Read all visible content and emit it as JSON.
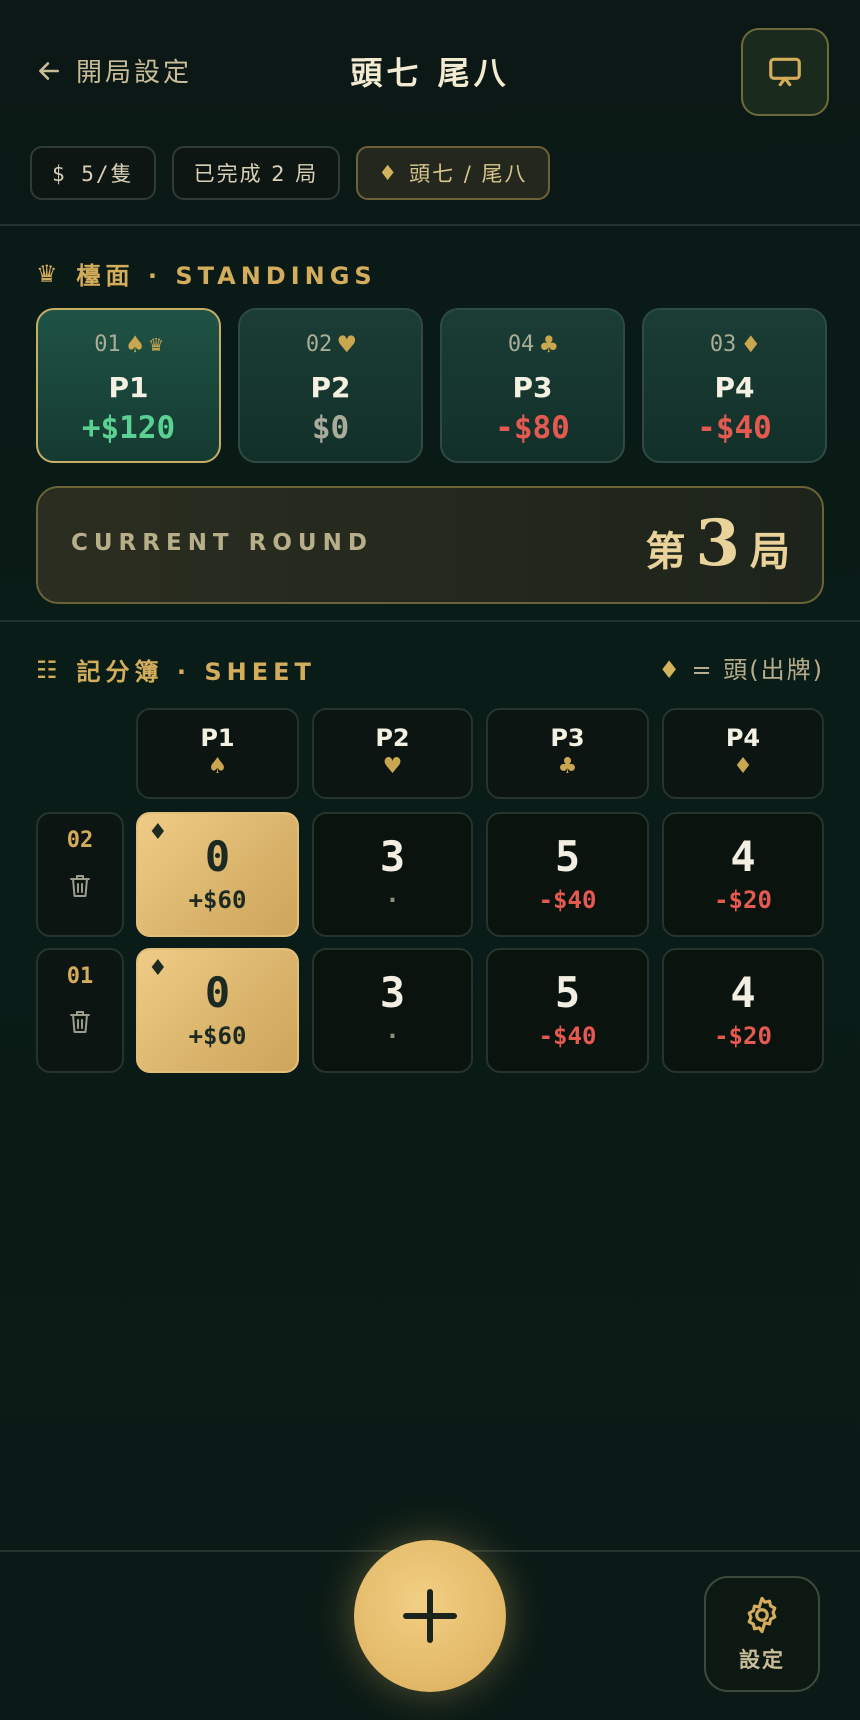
{
  "header": {
    "back_label": "開局設定",
    "title": "頭七 尾八"
  },
  "chips": {
    "stake": "$ 5/隻",
    "completed": "已完成 2 局",
    "rule_icon": "♦",
    "rule": "頭七 / 尾八"
  },
  "standings": {
    "icon": "♛",
    "label": "檯面 · STANDINGS",
    "players": [
      {
        "seat": "01",
        "suit": "♠",
        "crown": "♛",
        "name": "P1",
        "amount": "+$120"
      },
      {
        "seat": "02",
        "suit": "♥",
        "crown": "",
        "name": "P2",
        "amount": "$0"
      },
      {
        "seat": "04",
        "suit": "♣",
        "crown": "",
        "name": "P3",
        "amount": "-$80"
      },
      {
        "seat": "03",
        "suit": "♦",
        "crown": "",
        "name": "P4",
        "amount": "-$40"
      }
    ]
  },
  "current_round": {
    "label": "CURRENT ROUND",
    "prefix": "第",
    "number": "3",
    "suffix": "局"
  },
  "sheet": {
    "icon": "☷",
    "label": "記分簿 · SHEET",
    "legend_icon": "♦",
    "legend": "= 頭(出牌)",
    "headers": [
      {
        "name": "P1",
        "suit": "♠"
      },
      {
        "name": "P2",
        "suit": "♥"
      },
      {
        "name": "P3",
        "suit": "♣"
      },
      {
        "name": "P4",
        "suit": "♦"
      }
    ],
    "rows": [
      {
        "round": "02",
        "cells": [
          {
            "marker": "♦",
            "score": "0",
            "money": "+$60"
          },
          {
            "marker": "",
            "score": "3",
            "money": "·"
          },
          {
            "marker": "",
            "score": "5",
            "money": "-$40"
          },
          {
            "marker": "",
            "score": "4",
            "money": "-$20"
          }
        ]
      },
      {
        "round": "01",
        "cells": [
          {
            "marker": "♦",
            "score": "0",
            "money": "+$60"
          },
          {
            "marker": "",
            "score": "3",
            "money": "·"
          },
          {
            "marker": "",
            "score": "5",
            "money": "-$40"
          },
          {
            "marker": "",
            "score": "4",
            "money": "-$20"
          }
        ]
      }
    ]
  },
  "bottom": {
    "add_icon": "plus-icon",
    "settings_label": "設定"
  },
  "colors": {
    "gold": "#d4ad5c",
    "positive": "#5ad193",
    "negative": "#e45a50",
    "background": "#0b1815"
  }
}
